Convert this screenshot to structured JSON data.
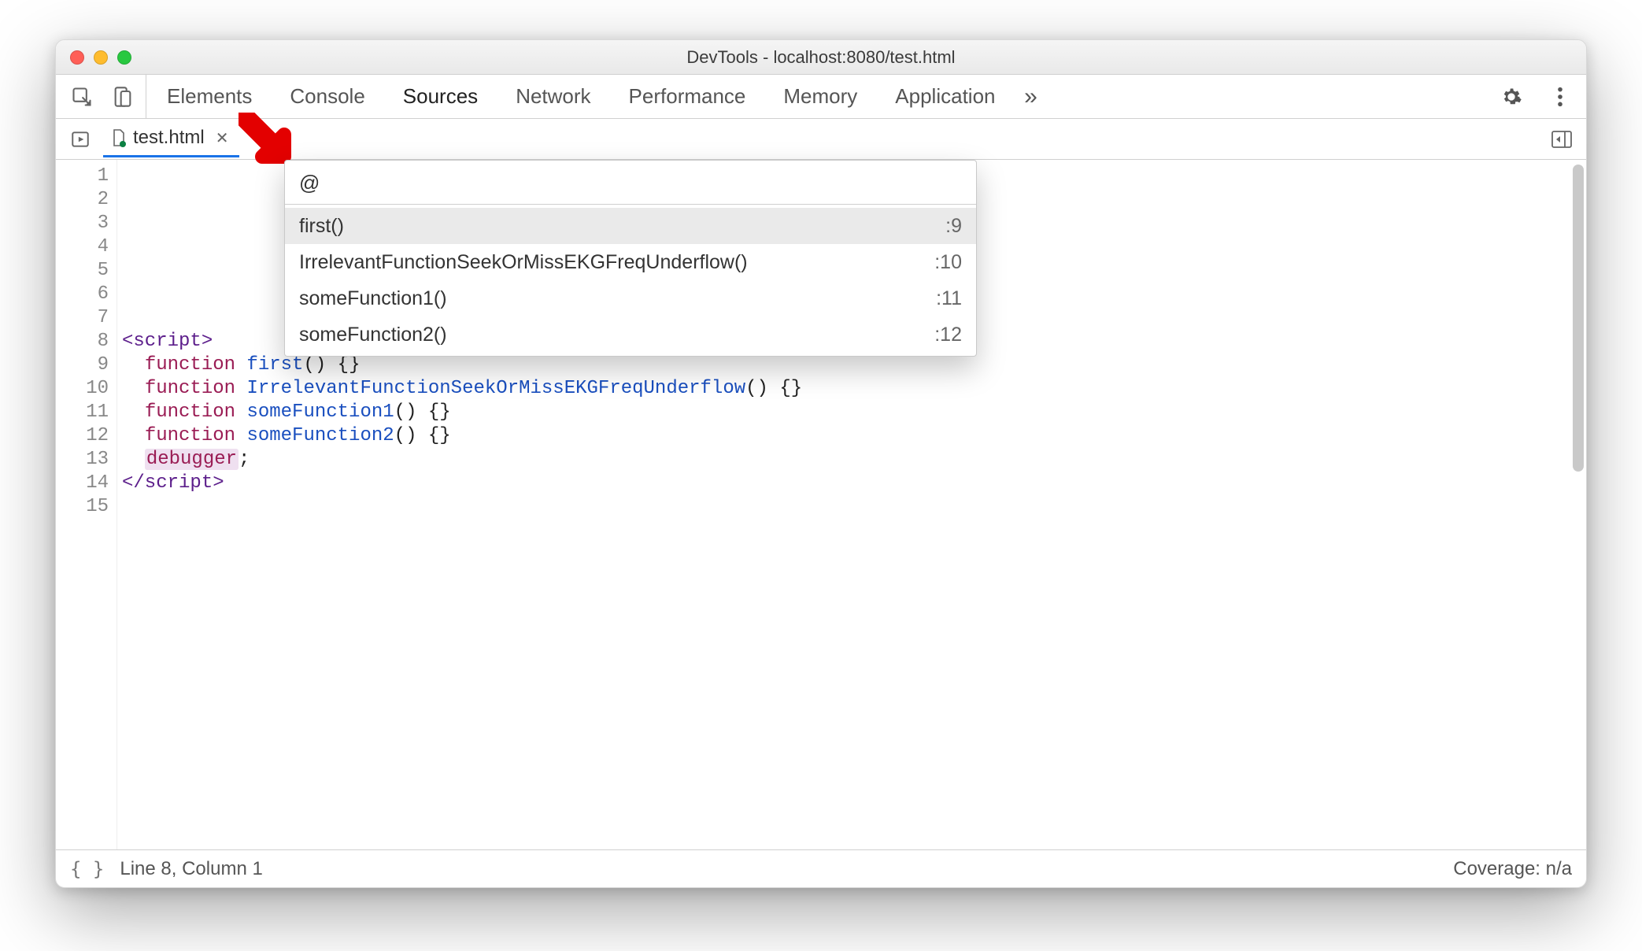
{
  "window": {
    "title": "DevTools - localhost:8080/test.html"
  },
  "tabs": {
    "items": [
      "Elements",
      "Console",
      "Sources",
      "Network",
      "Performance",
      "Memory",
      "Application"
    ],
    "active_index": 2
  },
  "file_tab": {
    "name": "test.html"
  },
  "command_menu": {
    "query": "@",
    "items": [
      {
        "label": "first()",
        "line": ":9"
      },
      {
        "label": "IrrelevantFunctionSeekOrMissEKGFreqUnderflow()",
        "line": ":10"
      },
      {
        "label": "someFunction1()",
        "line": ":11"
      },
      {
        "label": "someFunction2()",
        "line": ":12"
      }
    ],
    "selected_index": 0
  },
  "editor": {
    "line_count": 15,
    "lines": [
      {
        "n": 1,
        "tokens": []
      },
      {
        "n": 2,
        "tokens": []
      },
      {
        "n": 3,
        "tokens": []
      },
      {
        "n": 4,
        "tokens": []
      },
      {
        "n": 5,
        "tokens": []
      },
      {
        "n": 6,
        "tokens": []
      },
      {
        "n": 7,
        "tokens": []
      },
      {
        "n": 8,
        "tokens": [
          {
            "t": "<script>",
            "c": "tag"
          }
        ]
      },
      {
        "n": 9,
        "tokens": [
          {
            "t": "  ",
            "c": ""
          },
          {
            "t": "function",
            "c": "kw"
          },
          {
            "t": " ",
            "c": ""
          },
          {
            "t": "first",
            "c": "fn"
          },
          {
            "t": "() {}",
            "c": ""
          }
        ]
      },
      {
        "n": 10,
        "tokens": [
          {
            "t": "  ",
            "c": ""
          },
          {
            "t": "function",
            "c": "kw"
          },
          {
            "t": " ",
            "c": ""
          },
          {
            "t": "IrrelevantFunctionSeekOrMissEKGFreqUnderflow",
            "c": "fn"
          },
          {
            "t": "() {}",
            "c": ""
          }
        ]
      },
      {
        "n": 11,
        "tokens": [
          {
            "t": "  ",
            "c": ""
          },
          {
            "t": "function",
            "c": "kw"
          },
          {
            "t": " ",
            "c": ""
          },
          {
            "t": "someFunction1",
            "c": "fn"
          },
          {
            "t": "() {}",
            "c": ""
          }
        ]
      },
      {
        "n": 12,
        "tokens": [
          {
            "t": "  ",
            "c": ""
          },
          {
            "t": "function",
            "c": "kw"
          },
          {
            "t": " ",
            "c": ""
          },
          {
            "t": "someFunction2",
            "c": "fn"
          },
          {
            "t": "() {}",
            "c": ""
          }
        ]
      },
      {
        "n": 13,
        "tokens": [
          {
            "t": "  ",
            "c": ""
          },
          {
            "t": "debugger",
            "c": "debug"
          },
          {
            "t": ";",
            "c": ""
          }
        ]
      },
      {
        "n": 14,
        "tokens": [
          {
            "t": "</script>",
            "c": "tag"
          }
        ]
      },
      {
        "n": 15,
        "tokens": []
      }
    ]
  },
  "status": {
    "cursor": "Line 8, Column 1",
    "coverage": "Coverage: n/a"
  }
}
